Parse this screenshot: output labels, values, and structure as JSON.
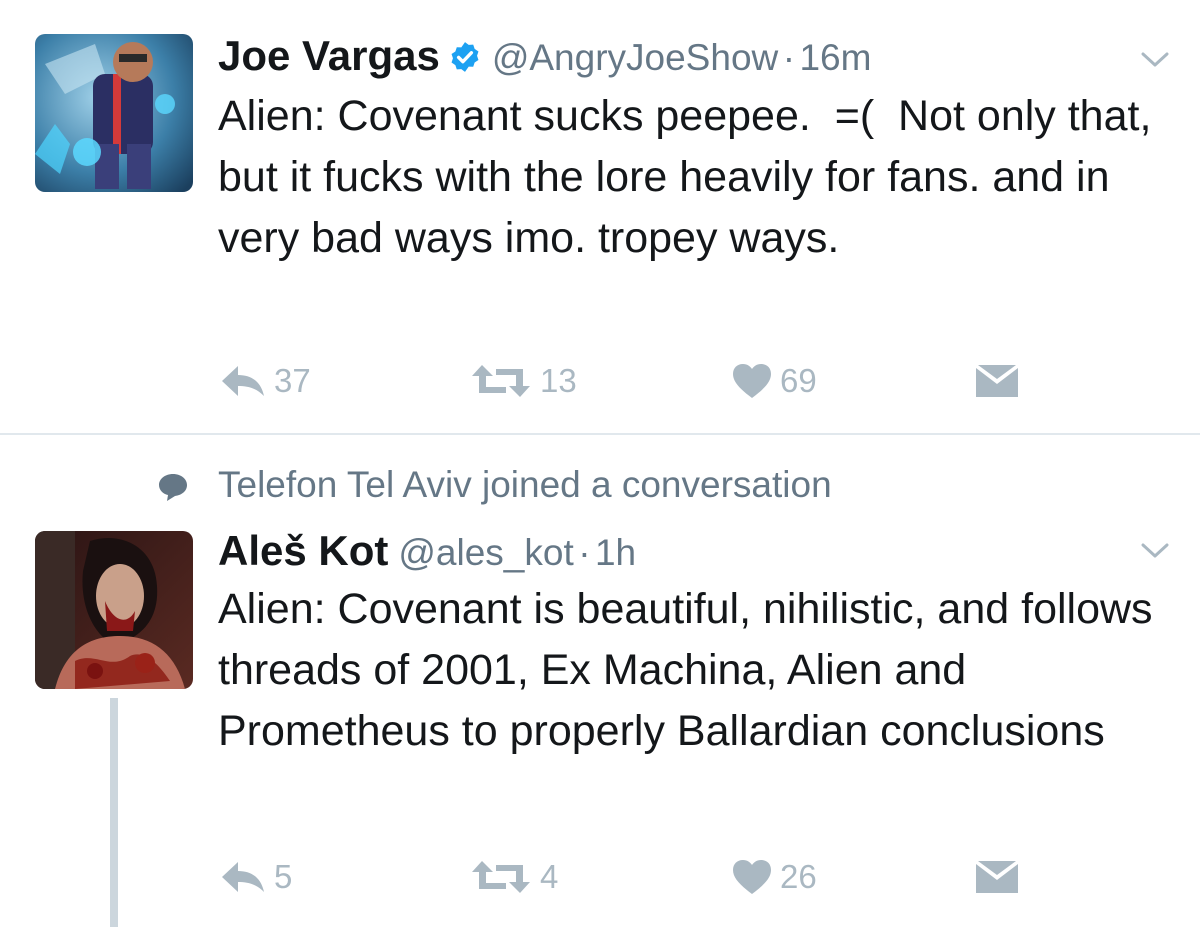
{
  "tweets": [
    {
      "name": "Joe Vargas",
      "verified": true,
      "handle": "@AngryJoeShow",
      "separator": "·",
      "time": "16m",
      "text": "Alien: Covenant sucks peepee.  =(  Not only that, but it fucks with the lore heavily for fans. and in very bad ways imo. tropey ways.",
      "avatar": "angry-joe-avatar",
      "actions": {
        "replies": "37",
        "retweets": "13",
        "likes": "69"
      }
    },
    {
      "context": "Telefon Tel Aviv joined a conversation",
      "name": "Aleš Kot",
      "verified": false,
      "handle": "@ales_kot",
      "separator": "·",
      "time": "1h",
      "text": "Alien: Covenant is beautiful, nihilistic, and follows threads of 2001, Ex Machina, Alien and Prometheus to properly Ballardian conclusions",
      "avatar": "ales-kot-avatar",
      "actions": {
        "replies": "5",
        "retweets": "4",
        "likes": "26"
      }
    }
  ],
  "icons": {
    "reply": "reply-icon",
    "retweet": "retweet-icon",
    "like": "heart-icon",
    "dm": "envelope-icon",
    "caret": "chevron-down-icon",
    "context": "speech-bubble-icon",
    "verified": "verified-badge-icon"
  },
  "colors": {
    "text": "#14171a",
    "secondary": "#657786",
    "action": "#aab8c2",
    "verified": "#1da1f2",
    "divider": "#e1e8ed",
    "thread_line": "#ccd6dd"
  }
}
